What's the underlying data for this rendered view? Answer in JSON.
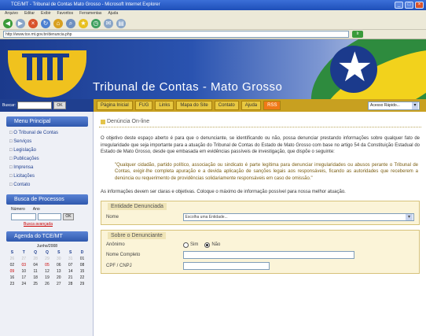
{
  "browser": {
    "title": "TCE/MT - Tribunal de Contas Mato Grosso - Microsoft Internet Explorer",
    "menu": [
      "Arquivo",
      "Editar",
      "Exibir",
      "Favoritos",
      "Ferramentas",
      "Ajuda"
    ],
    "address": "http://www.tce.mt.gov.br/denuncia.php",
    "go_label": "Ir"
  },
  "banner": {
    "title": "Tribunal de Contas - Mato Grosso"
  },
  "nav": {
    "search_label": "Buscar:",
    "search_button": "OK",
    "links": [
      "Página Inicial",
      "FUG",
      "Links",
      "Mapa do Site",
      "Contato",
      "Ajuda"
    ],
    "rss_label": "RSS",
    "quick_access": "Acesso Rápido..."
  },
  "sidebar": {
    "menu_title": "Menu Principal",
    "menu_items": [
      "O Tribunal de Contas",
      "Serviços",
      "Legislação",
      "Publicações",
      "Imprensa",
      "Licitações",
      "Contato"
    ],
    "process_title": "Busca de Processos",
    "process_number_label": "Número",
    "process_year_label": "Ano",
    "process_ok": "OK",
    "process_link": "Busca avançada",
    "agenda_title": "Agenda do TCE/MT",
    "calendar_month": "Junho/2008",
    "calendar_days": [
      "S",
      "T",
      "Q",
      "Q",
      "S",
      "S",
      "D"
    ],
    "calendar_rows": [
      [
        "26",
        "27",
        "28",
        "29",
        "30",
        "31",
        "01"
      ],
      [
        "02",
        "03",
        "04",
        "05",
        "06",
        "07",
        "08"
      ],
      [
        "09",
        "10",
        "11",
        "12",
        "13",
        "14",
        "15"
      ],
      [
        "16",
        "17",
        "18",
        "19",
        "20",
        "21",
        "22"
      ],
      [
        "23",
        "24",
        "25",
        "26",
        "27",
        "28",
        "29"
      ]
    ]
  },
  "content": {
    "page_title": "Denúncia On-line",
    "intro": "O objetivo deste espaço aberto é para que o denunciante, se identificando ou não, possa denunciar prestando informações sobre qualquer fato de irregularidade que seja importante para a atuação do Tribunal de Contas do Estado de Mato Grosso com base no artigo 54 da Constituição Estadual do Estado de Mato Grosso, desde que embasada em evidências passíveis de investigação, que dispõe o seguinte:",
    "quote": "\"Qualquer cidadão, partido político, associação ou sindicato é parte legítima para denunciar irregularidades ou abusos perante o Tribunal de Contas, exigir-lhe completa apuração e a devida aplicação de sanções legais aos responsáveis, ficando as autoridades que receberem a denúncia ou requerimento de providências solidariamente responsáveis em caso de omissão.\"",
    "info": "As informações devem ser claras e objetivas. Coloque o máximo de informação possível para nossa melhor atuação.",
    "entity": {
      "legend": "Entidade Denunciada",
      "name_label": "Nome",
      "select_value": "Escolha uma Entidade..."
    },
    "denunciante": {
      "legend": "Sobre o Denunciante",
      "anonymous_label": "Anônimo",
      "yes_label": "Sim",
      "no_label": "Não",
      "full_name_label": "Nome Completo",
      "doc_label": "CPF / CNPJ"
    }
  }
}
